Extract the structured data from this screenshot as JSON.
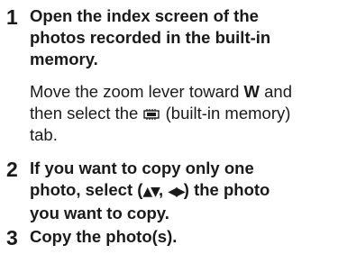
{
  "steps": [
    {
      "number": "1",
      "title_lines": [
        "Open the index screen of the",
        "photos recorded in the built-in",
        "memory."
      ],
      "body": {
        "line1_pre": "Move the zoom lever toward ",
        "line1_key": "W",
        "line1_post": " and",
        "line2_pre": "then select the ",
        "icon": "built-in-memory-icon",
        "line2_post": " (built-in memory)",
        "line3": "tab."
      }
    },
    {
      "number": "2",
      "title": {
        "line1": "If you want to copy only one",
        "line2_pre": "photo, select (",
        "updown_glyph": "▲▼",
        "comma": ", ",
        "leftright_glyph": "◀▶",
        "line2_post": ") the photo",
        "line3": "you want to copy."
      }
    },
    {
      "number": "3",
      "title_lines": [
        "Copy the photo(s)."
      ]
    }
  ]
}
